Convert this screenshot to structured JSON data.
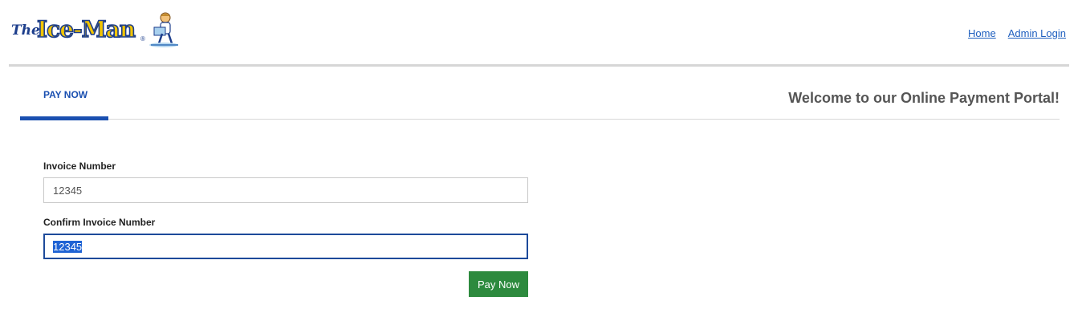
{
  "header": {
    "logo": {
      "prefix": "The",
      "brand": "Ice-Man",
      "reg": "®"
    },
    "nav": [
      {
        "label": "Home"
      },
      {
        "label": "Admin Login"
      }
    ]
  },
  "tabs": [
    {
      "label": "PAY NOW",
      "active": true
    }
  ],
  "welcome_text": "Welcome to our Online Payment Portal!",
  "form": {
    "invoice": {
      "label": "Invoice Number",
      "value": "12345"
    },
    "confirm": {
      "label": "Confirm Invoice Number",
      "value": "12345",
      "selected": true
    },
    "submit_label": "Pay Now"
  },
  "colors": {
    "accent": "#1a4fb0",
    "link": "#1f5fbf",
    "button": "#2d8a3e",
    "selection": "#1f63d4",
    "focus_border": "#1d4a9a"
  }
}
